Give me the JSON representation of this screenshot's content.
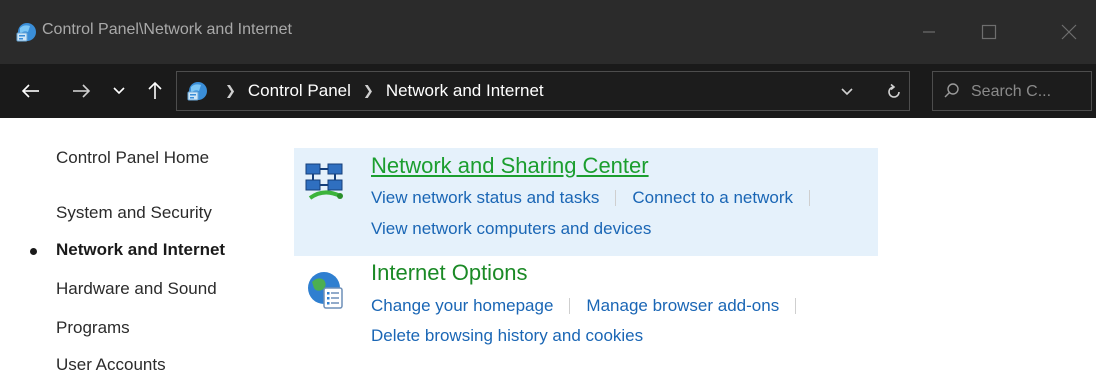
{
  "window": {
    "title": "Control Panel\\Network and Internet",
    "icon": "control-panel-icon"
  },
  "address": {
    "breadcrumbs": [
      "Control Panel",
      "Network and Internet"
    ],
    "search_placeholder": "Search C..."
  },
  "sidebar": {
    "items": [
      {
        "label": "Control Panel Home",
        "current": false
      },
      {
        "label": "System and Security",
        "current": false
      },
      {
        "label": "Network and Internet",
        "current": true
      },
      {
        "label": "Hardware and Sound",
        "current": false
      },
      {
        "label": "Programs",
        "current": false
      },
      {
        "label": "User Accounts",
        "current": false
      }
    ]
  },
  "categories": [
    {
      "title": "Network and Sharing Center",
      "icon": "network-sharing-icon",
      "tasks_row1": [
        "View network status and tasks",
        "Connect to a network"
      ],
      "tasks_row2": [
        "View network computers and devices"
      ]
    },
    {
      "title": "Internet Options",
      "icon": "internet-options-icon",
      "tasks_row1": [
        "Change your homepage",
        "Manage browser add-ons"
      ],
      "tasks_row2": [
        "Delete browsing history and cookies"
      ]
    }
  ],
  "colors": {
    "titlebar": "#2b2b2b",
    "addressbar": "#1a1a1a",
    "highlight": "#e5f1fb",
    "link": "#1a66b5",
    "category_title": "#1b9e2f"
  }
}
